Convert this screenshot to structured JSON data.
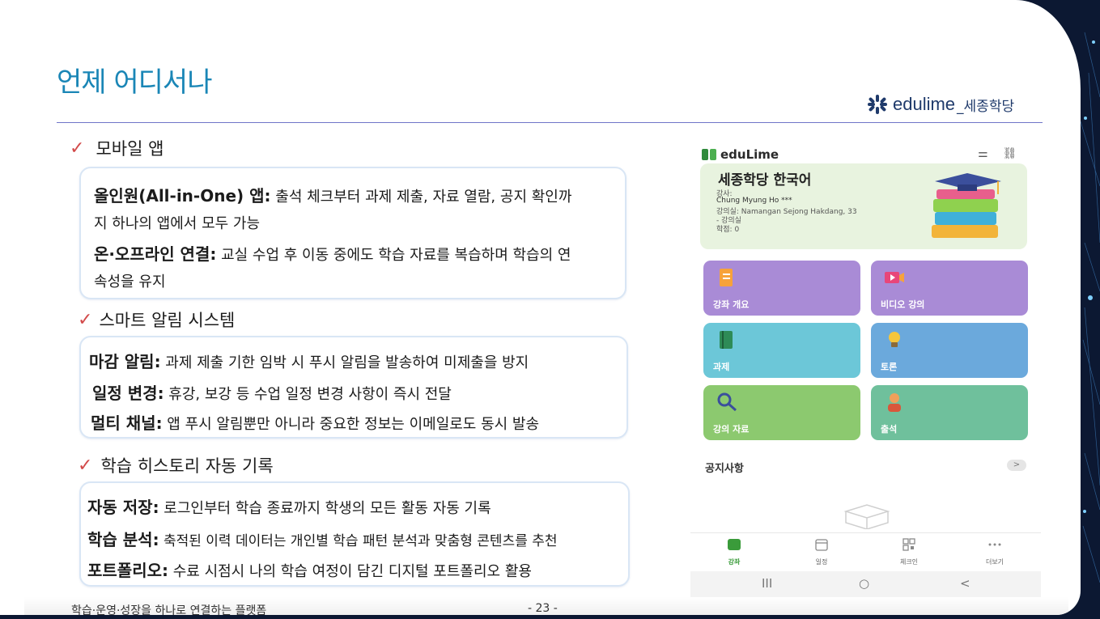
{
  "slide": {
    "title": "언제 어디서나",
    "logo_text": "edulime",
    "logo_sub": "_세종학당",
    "footer_left": "학습·운영·성장을 하나로 연결하는 플랫폼",
    "page": "- 23 -"
  },
  "sections": [
    {
      "label": "모바일 앱",
      "lines": [
        {
          "key": "올인원(All-in-One) 앱:",
          "value": " 출석 체크부터 과제 제출, 자료 열람, 공지 확인까"
        },
        {
          "key": "",
          "value": "지 하나의 앱에서 모두 가능"
        },
        {
          "key": "온·오프라인 연결:",
          "value": " 교실 수업 후 이동 중에도 학습 자료를 복습하며 학습의 연"
        },
        {
          "key": "",
          "value": "속성을 유지"
        }
      ]
    },
    {
      "label": "스마트 알림 시스템",
      "lines": [
        {
          "key": "마감 알림:",
          "value": " 과제 제출 기한 임박 시 푸시 알림을 발송하여 미제출을 방지"
        },
        {
          "key": "일정 변경:",
          "value": " 휴강, 보강 등 수업 일정 변경 사항이 즉시 전달"
        },
        {
          "key": "멀티 채널:",
          "value": " 앱 푸시 알림뿐만 아니라 중요한 정보는 이메일로도 동시 발송"
        }
      ]
    },
    {
      "label": "학습 히스토리 자동 기록",
      "lines": [
        {
          "key": "자동 저장:",
          "value": " 로그인부터 학습 종료까지 학생의 모든 활동 자동 기록"
        },
        {
          "key": "학습 분석:",
          "value": " 축적된 이력 데이터는 개인별 학습 패턴 분석과 맞춤형 콘텐츠를 추천"
        },
        {
          "key": "포트폴리오:",
          "value": " 수료 시점시 나의 학습 여정이 담긴 디지털 포트폴리오 활용"
        }
      ]
    }
  ],
  "phone": {
    "brand": "eduLime",
    "course_title": "세종학당 한국어",
    "teacher_label": "강사:",
    "teacher_name": "Chung Myung Ho ***",
    "room": "강의실: Namangan Sejong Hakdang, 33",
    "room2": "- 강의실",
    "credits": "학점: 0",
    "tiles": [
      {
        "label": "강좌 개요",
        "color": "#a98bd6",
        "icon": "document-icon"
      },
      {
        "label": "비디오 강의",
        "color": "#a98bd6",
        "icon": "video-icon"
      },
      {
        "label": "과제",
        "color": "#6cc7d8",
        "icon": "notebook-icon"
      },
      {
        "label": "토론",
        "color": "#6ba9dc",
        "icon": "lightbulb-icon"
      },
      {
        "label": "강의 자료",
        "color": "#8cc96f",
        "icon": "magnifier-icon"
      },
      {
        "label": "출석",
        "color": "#6fc09c",
        "icon": "person-icon"
      }
    ],
    "notice": "공지사항",
    "notice_more": ">",
    "nav": [
      {
        "label": "강좌",
        "icon": "book-icon"
      },
      {
        "label": "일정",
        "icon": "calendar-icon"
      },
      {
        "label": "체크인",
        "icon": "qr-icon"
      },
      {
        "label": "더보기",
        "icon": "more-icon"
      }
    ],
    "sys": {
      "recent": "III",
      "home": "○",
      "back": "<"
    }
  },
  "colors": {
    "title": "#1a86b6",
    "check": "#d24a4a",
    "active_nav": "#3a9b3a"
  }
}
